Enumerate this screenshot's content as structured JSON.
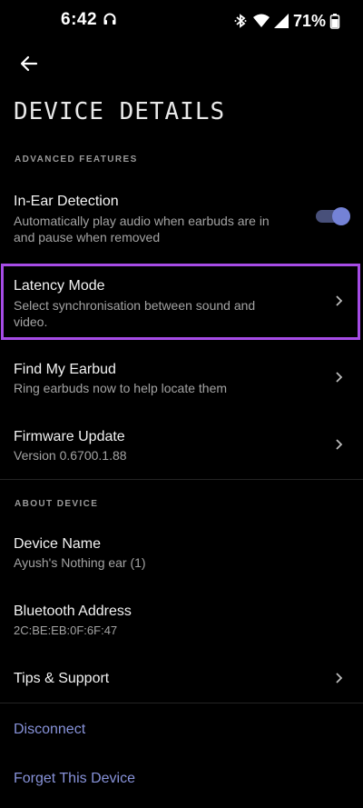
{
  "status_bar": {
    "time": "6:42",
    "battery": "71%"
  },
  "page": {
    "title": "DEVICE DETAILS"
  },
  "advanced": {
    "header": "ADVANCED FEATURES",
    "in_ear": {
      "title": "In-Ear Detection",
      "subtitle_line1": "Automatically play audio when earbuds are in",
      "subtitle_line2": "and pause when removed",
      "enabled": true
    },
    "latency": {
      "title": "Latency Mode",
      "subtitle_line1": "Select synchronisation between sound and",
      "subtitle_line2": "video."
    },
    "find": {
      "title": "Find My Earbud",
      "subtitle": "Ring earbuds now to help locate them"
    },
    "firmware": {
      "title": "Firmware Update",
      "subtitle": "Version 0.6700.1.88"
    }
  },
  "about": {
    "header": "ABOUT DEVICE",
    "name": {
      "title": "Device Name",
      "value": "Ayush's Nothing ear (1)"
    },
    "bt": {
      "title": "Bluetooth Address",
      "value": "2C:BE:EB:0F:6F:47"
    },
    "tips": {
      "title": "Tips & Support"
    }
  },
  "actions": {
    "disconnect": "Disconnect",
    "forget": "Forget This Device"
  },
  "colors": {
    "accent": "#8792d9",
    "highlight": "#a64ce6",
    "background": "#000000"
  }
}
